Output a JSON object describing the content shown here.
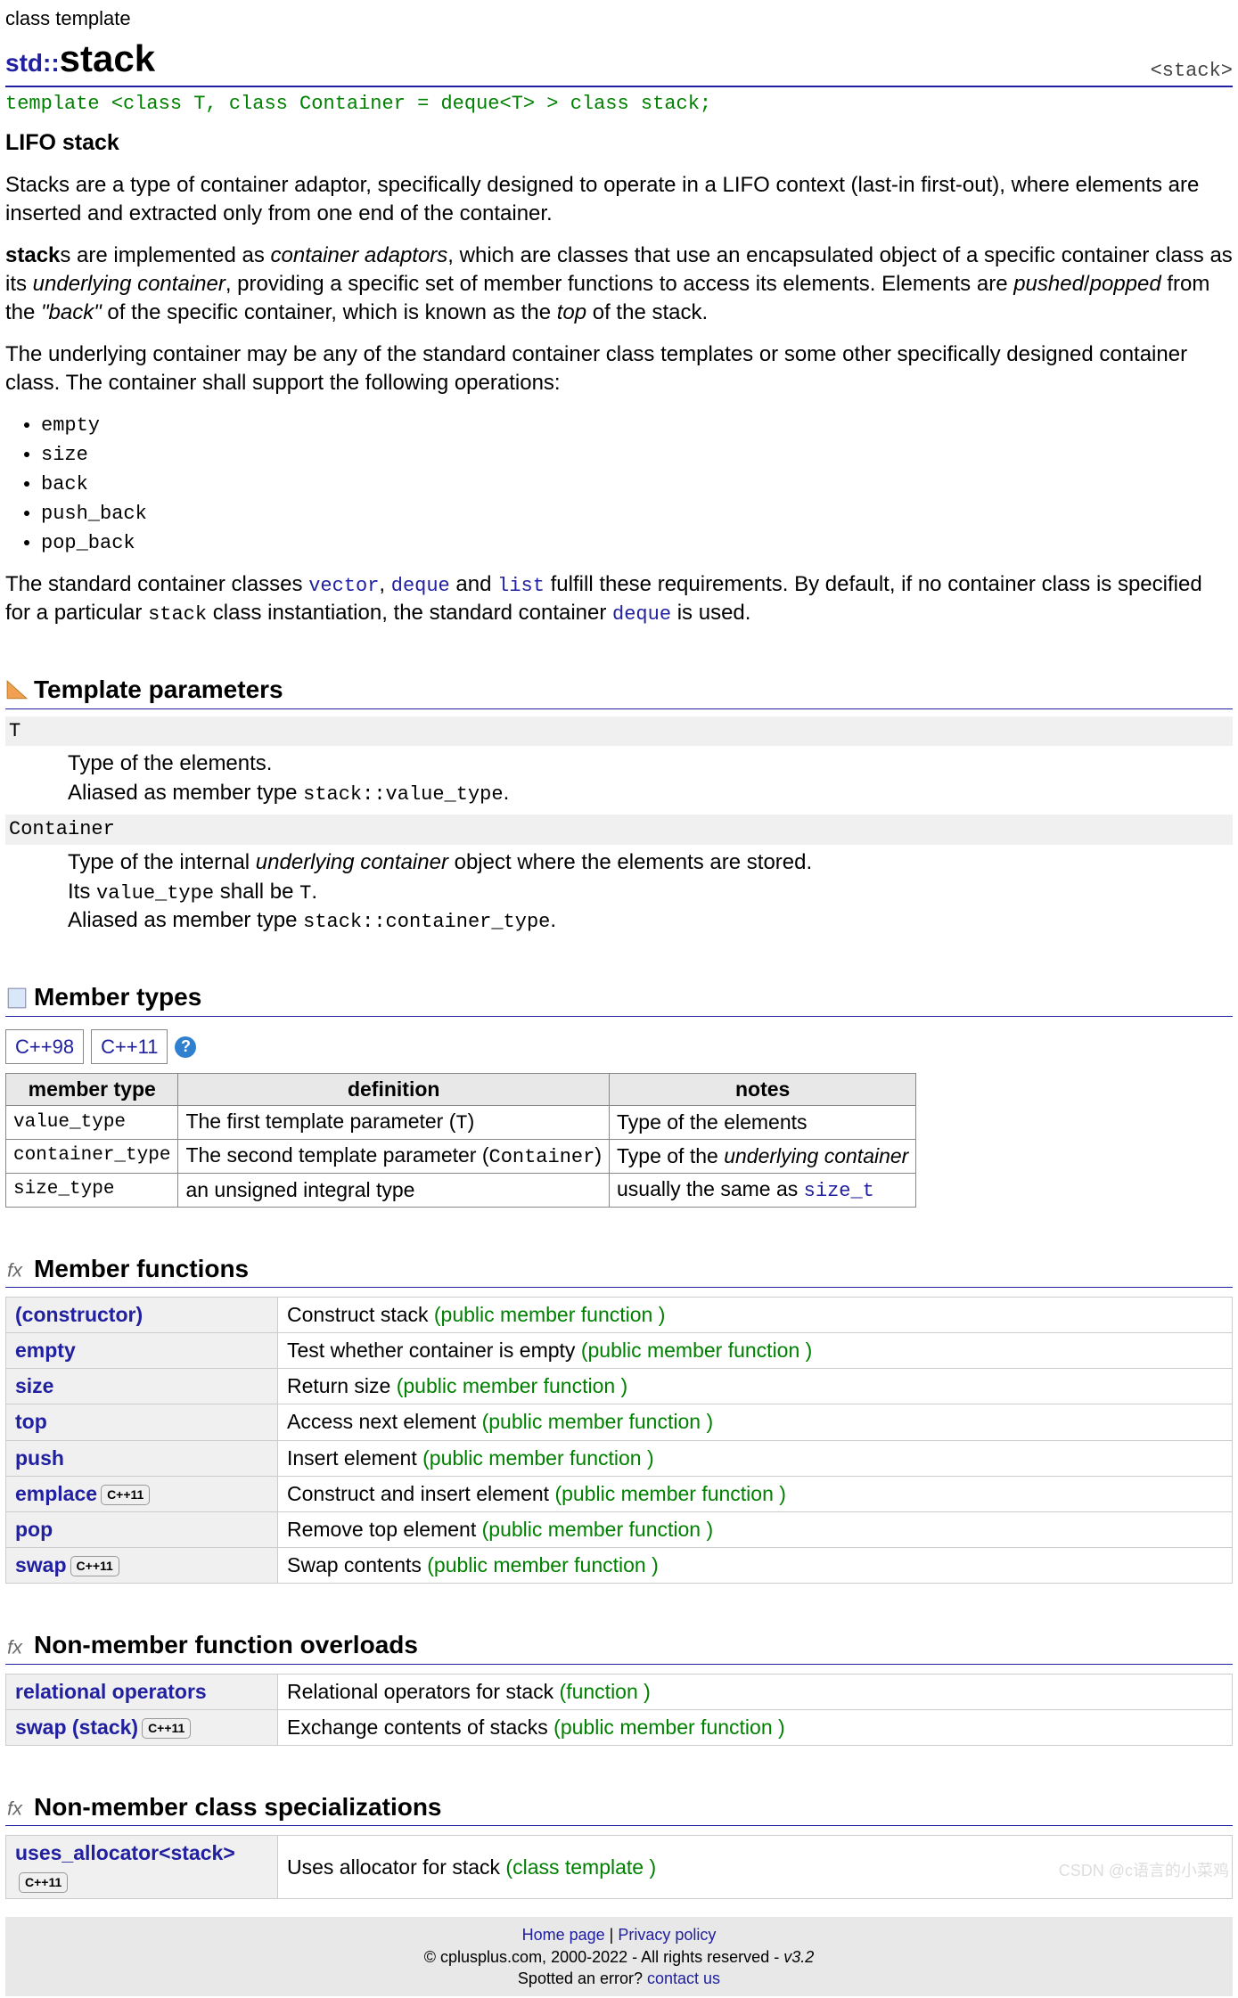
{
  "category": "class template",
  "namespace": "std::",
  "class_name": "stack",
  "header_tag": "<stack>",
  "template_decl": "template <class T, class Container = deque<T> > class stack;",
  "subtitle": "LIFO stack",
  "intro_p1": "Stacks are a type of container adaptor, specifically designed to operate in a LIFO context (last-in first-out), where elements are inserted and extracted only from one end of the container.",
  "intro_p2_a": "stack",
  "intro_p2_b": "s are implemented as ",
  "intro_p2_c": "container adaptors",
  "intro_p2_d": ", which are classes that use an encapsulated object of a specific container class as its ",
  "intro_p2_e": "underlying container",
  "intro_p2_f": ", providing a specific set of member functions to access its elements. Elements are ",
  "intro_p2_g": "pushed",
  "intro_p2_h": "/",
  "intro_p2_i": "popped",
  "intro_p2_j": " from the ",
  "intro_p2_k": "\"back\"",
  "intro_p2_l": " of the specific container, which is known as the ",
  "intro_p2_m": "top",
  "intro_p2_n": " of the stack.",
  "intro_p3": "The underlying container may be any of the standard container class templates or some other specifically designed container class. The container shall support the following operations:",
  "ops": [
    "empty",
    "size",
    "back",
    "push_back",
    "pop_back"
  ],
  "intro_p4_a": "The standard container classes ",
  "intro_p4_b": "vector",
  "intro_p4_c": ", ",
  "intro_p4_d": "deque",
  "intro_p4_e": " and ",
  "intro_p4_f": "list",
  "intro_p4_g": " fulfill these requirements. By default, if no container class is specified for a particular ",
  "intro_p4_h": "stack",
  "intro_p4_i": " class instantiation, the standard container ",
  "intro_p4_j": "deque",
  "intro_p4_k": " is used.",
  "sec_template_params": "Template parameters",
  "param_T": "T",
  "param_T_desc1": "Type of the elements.",
  "param_T_desc2a": "Aliased as member type ",
  "param_T_desc2b": "stack::value_type",
  "param_T_desc2c": ".",
  "param_C": "Container",
  "param_C_desc1a": "Type of the internal ",
  "param_C_desc1b": "underlying container",
  "param_C_desc1c": " object where the elements are stored.",
  "param_C_desc2a": "Its ",
  "param_C_desc2b": "value_type",
  "param_C_desc2c": " shall be ",
  "param_C_desc2d": "T",
  "param_C_desc2e": ".",
  "param_C_desc3a": "Aliased as member type ",
  "param_C_desc3b": "stack::container_type",
  "param_C_desc3c": ".",
  "sec_member_types": "Member types",
  "tabs": {
    "cpp98": "C++98",
    "cpp11": "C++11",
    "help": "?"
  },
  "types_hdr": {
    "c0": "member type",
    "c1": "definition",
    "c2": "notes"
  },
  "types": [
    {
      "name": "value_type",
      "def_a": "The first template parameter (",
      "def_b": "T",
      "def_c": ")",
      "note_plain": "Type of the elements"
    },
    {
      "name": "container_type",
      "def_a": "The second template parameter (",
      "def_b": "Container",
      "def_c": ")",
      "note_a": "Type of the ",
      "note_b": "underlying container"
    },
    {
      "name": "size_type",
      "def_plain": "an unsigned integral type",
      "note_c": "usually the same as ",
      "note_d": "size_t"
    }
  ],
  "sec_member_funcs": "Member functions",
  "funcs": [
    {
      "name": "(constructor)",
      "desc": "Construct stack ",
      "suffix": "(public member function )"
    },
    {
      "name": "empty",
      "desc": "Test whether container is empty ",
      "suffix": "(public member function )"
    },
    {
      "name": "size",
      "desc": "Return size ",
      "suffix": "(public member function )"
    },
    {
      "name": "top",
      "desc": "Access next element ",
      "suffix": "(public member function )"
    },
    {
      "name": "push",
      "desc": "Insert element ",
      "suffix": "(public member function )"
    },
    {
      "name": "emplace",
      "badge": "C++11",
      "desc": "Construct and insert element ",
      "suffix": "(public member function )"
    },
    {
      "name": "pop",
      "desc": "Remove top element ",
      "suffix": "(public member function )"
    },
    {
      "name": "swap",
      "badge": "C++11",
      "desc": "Swap contents ",
      "suffix": "(public member function )"
    }
  ],
  "sec_nonmember_funcs": "Non-member function overloads",
  "nonmember_funcs": [
    {
      "name": "relational operators",
      "desc": "Relational operators for stack ",
      "suffix": "(function )"
    },
    {
      "name": "swap (stack)",
      "badge": "C++11",
      "desc": "Exchange contents of stacks ",
      "suffix": "(public member function )"
    }
  ],
  "sec_nonmember_specs": "Non-member class specializations",
  "specs": [
    {
      "name": "uses_allocator<stack>",
      "badge": "C++11",
      "desc": "Uses allocator for stack ",
      "suffix": "(class template )"
    }
  ],
  "footer": {
    "home": "Home page",
    "sep": " | ",
    "privacy": "Privacy policy",
    "copy": "© cplusplus.com, 2000-2022 - All rights reserved - ",
    "ver": "v3.2",
    "err_a": "Spotted an error? ",
    "err_b": "contact us"
  },
  "watermark": "CSDN @c语言的小菜鸡"
}
